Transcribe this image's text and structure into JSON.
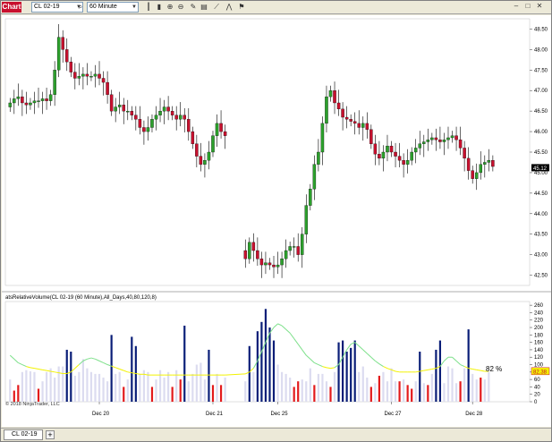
{
  "window": {
    "title": "Chart",
    "instrument": "CL 02-19",
    "interval": "60 Minute",
    "tab_label": "CL 02-19",
    "add_tab": "+"
  },
  "toolbar_icons": [
    "search-icon",
    "bar-chart-icon",
    "candlestick-icon",
    "zoom-in-icon",
    "zoom-out-icon",
    "edit-icon",
    "properties-icon",
    "drawing-tools-icon",
    "indicators-icon",
    "strategy-icon"
  ],
  "colors": {
    "up": "#2ca02c",
    "down": "#c8102e",
    "volume_blue": "#0a1e78",
    "volume_red": "#e31a1c",
    "volume_light": "#dcdcf0",
    "green_line": "#7de08a",
    "yellow_line": "#f2f200",
    "price_marker": "#000000"
  },
  "copyright": "© 2018 NinjaTrader, LLC",
  "indicator_label": "atsRelativeVolume(CL 02-19 (60 Minute),All_Days,40,80,120,8)",
  "percent_label": "82 %",
  "chart_data": [
    {
      "type": "candlestick",
      "instrument": "CL 02-19",
      "interval": "60 Minute",
      "y_ticks": [
        42.5,
        43.0,
        43.5,
        44.0,
        44.5,
        45.0,
        45.5,
        46.0,
        46.5,
        47.0,
        47.5,
        48.0,
        48.5
      ],
      "ylim": [
        42.25,
        48.75
      ],
      "last_price": 45.12,
      "x_ticks": [
        "Dec 20",
        "Dec 21",
        "Dec 25",
        "Dec 27",
        "Dec 28"
      ],
      "close": [
        46.7,
        46.8,
        46.85,
        46.7,
        46.65,
        46.7,
        46.75,
        46.75,
        46.8,
        46.75,
        46.9,
        47.5,
        48.3,
        48.0,
        47.7,
        47.45,
        47.3,
        47.35,
        47.4,
        47.35,
        47.35,
        47.4,
        47.3,
        47.2,
        46.9,
        46.5,
        46.6,
        46.65,
        46.5,
        46.5,
        46.4,
        46.3,
        46.1,
        46.0,
        46.1,
        46.3,
        46.4,
        46.5,
        46.6,
        46.5,
        46.4,
        46.3,
        46.4,
        46.3,
        46.0,
        45.7,
        45.4,
        45.2,
        45.3,
        45.5,
        45.9,
        46.2,
        46.0,
        45.9,
        42.9,
        43.3,
        43.1,
        42.9,
        42.75,
        42.8,
        42.75,
        42.7,
        42.75,
        42.9,
        43.1,
        43.2,
        43.2,
        43.0,
        43.5,
        44.2,
        44.6,
        45.2,
        45.5,
        46.2,
        46.85,
        47.0,
        46.7,
        46.55,
        46.35,
        46.3,
        46.25,
        46.2,
        46.1,
        46.2,
        46.05,
        45.7,
        45.45,
        45.35,
        45.5,
        45.65,
        45.5,
        45.4,
        45.3,
        45.2,
        45.3,
        45.5,
        45.6,
        45.7,
        45.75,
        45.8,
        45.85,
        45.8,
        45.75,
        45.8,
        45.85,
        45.9,
        45.8,
        45.6,
        45.35,
        45.05,
        44.85,
        45.0,
        45.2,
        45.25,
        45.3,
        45.15
      ],
      "open": [
        46.6,
        46.7,
        46.8,
        46.85,
        46.7,
        46.65,
        46.7,
        46.75,
        46.75,
        46.8,
        46.75,
        46.9,
        47.5,
        48.3,
        48.0,
        47.7,
        47.45,
        47.3,
        47.35,
        47.4,
        47.35,
        47.35,
        47.4,
        47.3,
        47.2,
        46.9,
        46.5,
        46.6,
        46.65,
        46.5,
        46.5,
        46.4,
        46.3,
        46.1,
        46.0,
        46.1,
        46.3,
        46.4,
        46.5,
        46.6,
        46.5,
        46.4,
        46.3,
        46.4,
        46.3,
        46.0,
        45.7,
        45.4,
        45.2,
        45.3,
        45.5,
        45.9,
        46.2,
        46.0,
        43.1,
        42.9,
        43.3,
        43.1,
        42.9,
        42.75,
        42.8,
        42.75,
        42.7,
        42.75,
        42.9,
        43.1,
        43.2,
        43.2,
        43.0,
        43.5,
        44.2,
        44.6,
        45.2,
        45.5,
        46.2,
        46.85,
        47.0,
        46.7,
        46.55,
        46.35,
        46.3,
        46.25,
        46.2,
        46.1,
        46.2,
        46.05,
        45.7,
        45.45,
        45.35,
        45.5,
        45.65,
        45.5,
        45.4,
        45.3,
        45.2,
        45.3,
        45.5,
        45.6,
        45.7,
        45.75,
        45.8,
        45.85,
        45.8,
        45.75,
        45.8,
        45.85,
        45.9,
        45.8,
        45.6,
        45.35,
        45.05,
        44.85,
        45.0,
        45.2,
        45.25,
        45.3
      ]
    },
    {
      "type": "bar",
      "title": "atsRelativeVolume(CL 02-19 (60 Minute),All_Days,40,80,120,8)",
      "y_ticks": [
        0,
        20,
        40,
        60,
        80,
        100,
        120,
        140,
        160,
        180,
        200,
        220,
        240,
        260
      ],
      "ylim": [
        0,
        270
      ],
      "last_value": 82.38,
      "volume": [
        60,
        30,
        45,
        80,
        85,
        82,
        80,
        35,
        55,
        80,
        90,
        65,
        95,
        95,
        140,
        135,
        70,
        80,
        115,
        90,
        80,
        75,
        75,
        65,
        55,
        180,
        75,
        80,
        40,
        60,
        175,
        150,
        75,
        85,
        80,
        40,
        60,
        85,
        65,
        80,
        40,
        85,
        60,
        205,
        55,
        75,
        100,
        105,
        60,
        140,
        45,
        75,
        45,
        65,
        55,
        150,
        80,
        190,
        215,
        250,
        200,
        165,
        100,
        80,
        75,
        65,
        40,
        55,
        60,
        55,
        90,
        45,
        75,
        75,
        55,
        40,
        80,
        160,
        165,
        135,
        145,
        165,
        80,
        95,
        65,
        40,
        50,
        70,
        80,
        55,
        90,
        55,
        55,
        60,
        45,
        35,
        55,
        135,
        50,
        45,
        75,
        140,
        165,
        50,
        95,
        90,
        50,
        55,
        90,
        195,
        75,
        60,
        65,
        60,
        80
      ],
      "avg": [
        125,
        115,
        105,
        100,
        95,
        92,
        90,
        88,
        86,
        84,
        82,
        80,
        78,
        76,
        76,
        80,
        90,
        100,
        110,
        115,
        118,
        115,
        110,
        105,
        100,
        96,
        92,
        88,
        84,
        80,
        78,
        76,
        74,
        74,
        72,
        72,
        72,
        72,
        72,
        72,
        72,
        72,
        72,
        72,
        72,
        72,
        72,
        72,
        72,
        72,
        72,
        72,
        72,
        72,
        75,
        80,
        90,
        110,
        135,
        160,
        185,
        200,
        210,
        205,
        195,
        185,
        170,
        155,
        140,
        125,
        115,
        105,
        100,
        95,
        92,
        90,
        92,
        100,
        120,
        140,
        155,
        160,
        150,
        140,
        130,
        120,
        110,
        102,
        95,
        90,
        86,
        82,
        80,
        80,
        80,
        80,
        80,
        82,
        84,
        86,
        88,
        90,
        95,
        110,
        120,
        120,
        110,
        100,
        95,
        90,
        88,
        86,
        84,
        82,
        82
      ]
    }
  ]
}
